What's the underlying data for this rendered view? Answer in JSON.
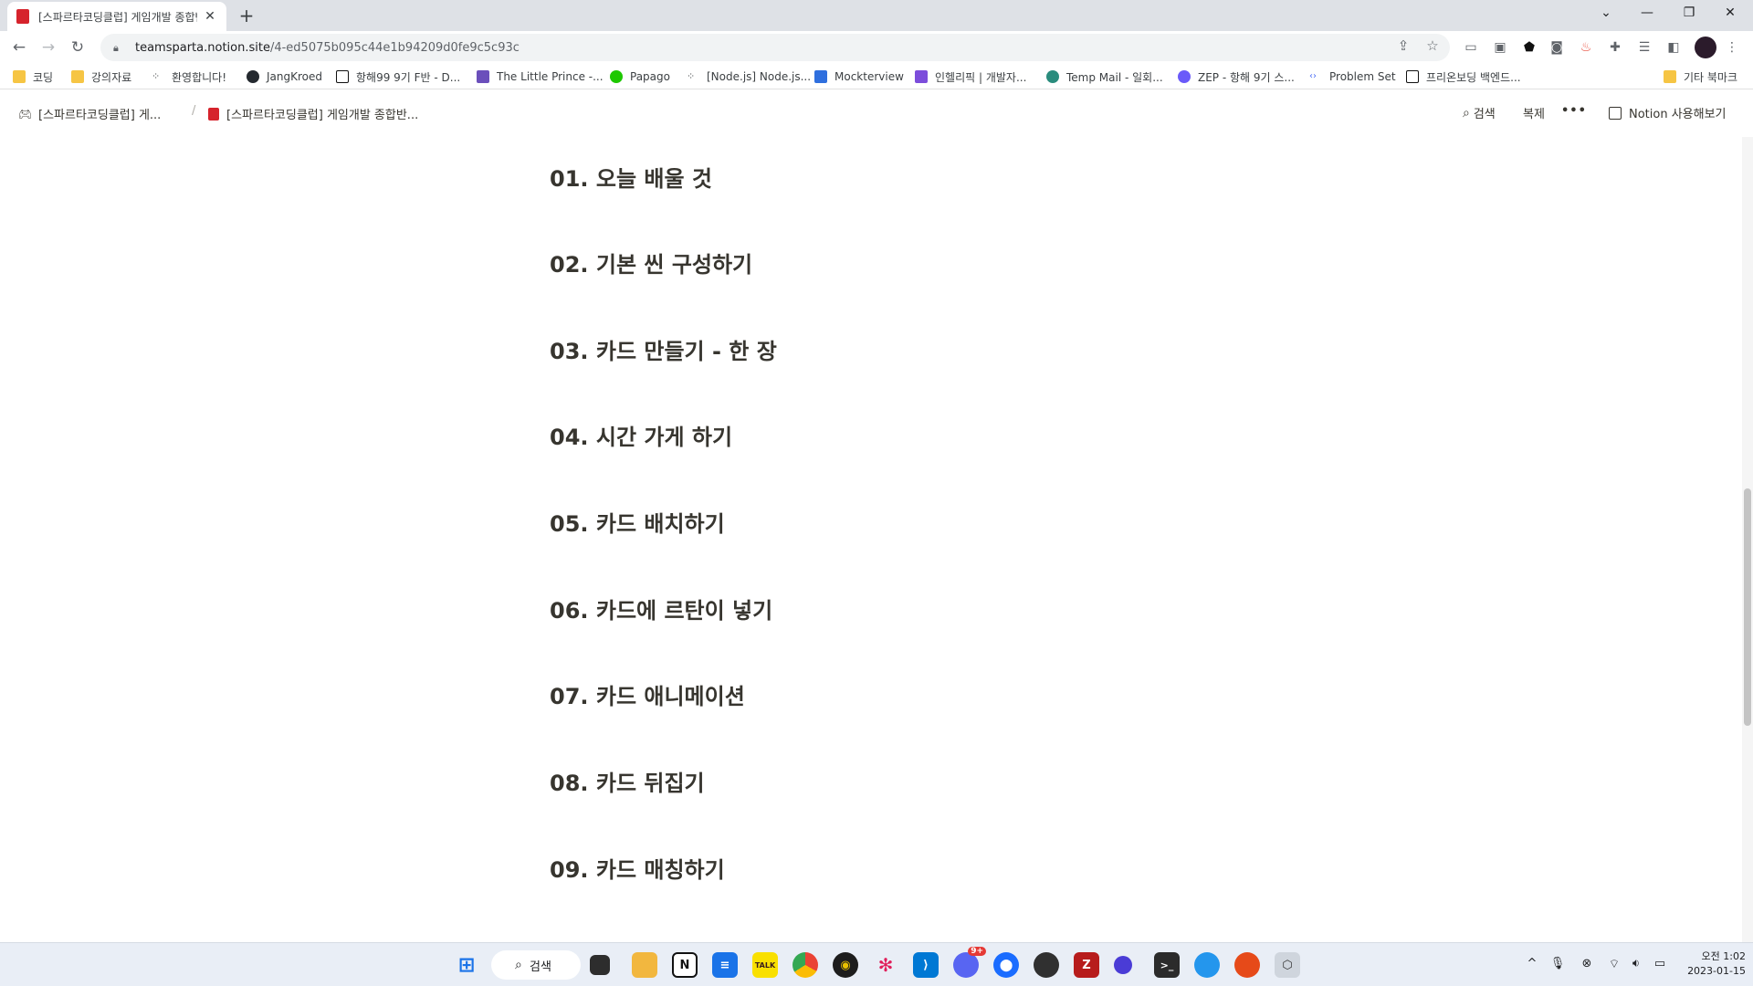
{
  "browser": {
    "tab_title": "[스파르타코딩클럽] 게임개발 종합반",
    "new_tab": "+",
    "url_host": "teamsparta.notion.site",
    "url_path": "/4-ed5075b095c44e1b94209d0fe9c5c93c"
  },
  "bookmarks": [
    {
      "label": "코딩",
      "color": "#f6c544"
    },
    {
      "label": "강의자료",
      "color": "#f6c544"
    },
    {
      "label": "환영합니다!",
      "color": "#3c4043"
    },
    {
      "label": "JangKroed",
      "color": "#24292f"
    },
    {
      "label": "항해99 9기 F반 - D...",
      "color": "#111111"
    },
    {
      "label": "The Little Prince -...",
      "color": "#6b4fbb"
    },
    {
      "label": "Papago",
      "color": "#1ec800"
    },
    {
      "label": "[Node.js] Node.js...",
      "color": "#3c4043"
    },
    {
      "label": "Mockterview",
      "color": "#2f6fde"
    },
    {
      "label": "인헬리픽 | 개발자...",
      "color": "#7c4ddb"
    },
    {
      "label": "Temp Mail - 일회...",
      "color": "#2a8c7d"
    },
    {
      "label": "ZEP - 항해 9기 스...",
      "color": "#6a5af9"
    },
    {
      "label": "Problem Set",
      "color": "#4c6ef5"
    },
    {
      "label": "프리온보딩 백엔드...",
      "color": "#111111"
    }
  ],
  "other_bookmarks": "기타 북마크",
  "notion": {
    "breadcrumb_1": "[스파르타코딩클럽] 게...",
    "breadcrumb_2": "[스파르타코딩클럽] 게임개발 종합반...",
    "breadcrumb_sep": "/",
    "search_label": "검색",
    "duplicate_label": "복제",
    "more_label": "•••",
    "try_notion_label": "Notion 사용해보기"
  },
  "headings": [
    "01. 오늘 배울 것",
    "02. 기본 씬 구성하기",
    "03. 카드 만들기 - 한 장",
    "04. 시간 가게 하기",
    "05. 카드 배치하기",
    "06. 카드에 르탄이 넣기",
    "07. 카드 애니메이션",
    "08. 카드 뒤집기",
    "09. 카드 매칭하기"
  ],
  "taskbar": {
    "search_label": "검색",
    "kakao_label": "TALK",
    "clock_time": "오전 1:02",
    "clock_date": "2023-01-15",
    "discord_badge": "9+"
  }
}
